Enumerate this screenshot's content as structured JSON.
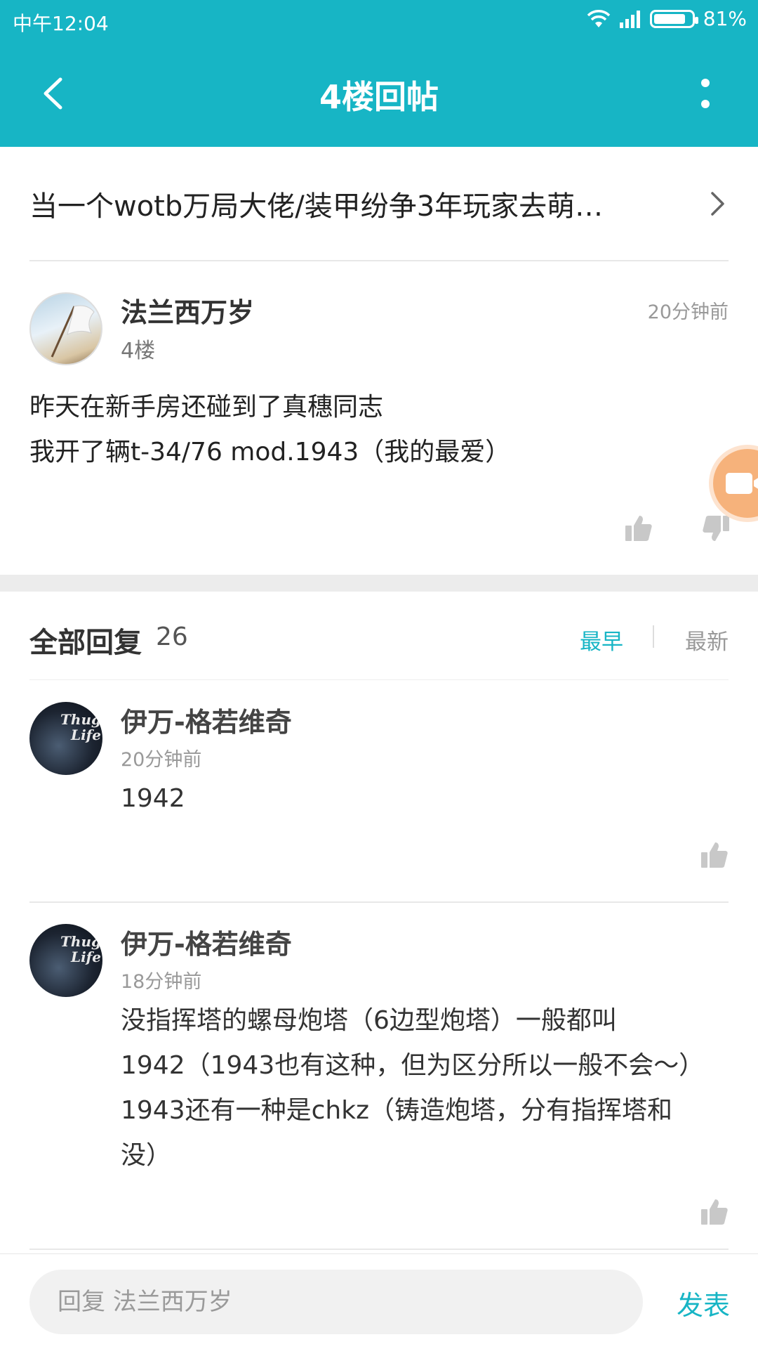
{
  "status_bar": {
    "time": "中午12:04",
    "battery": "81%",
    "icons": [
      "wifi-icon",
      "signal-icon",
      "battery-icon"
    ]
  },
  "header": {
    "title": "4楼回帖",
    "back_icon": "chevron-left-icon",
    "more_icon": "more-vertical-icon"
  },
  "thread": {
    "title": "当一个wotb万局大佬/装甲纷争3年玩家去萌…"
  },
  "post": {
    "author": "法兰西万岁",
    "floor": "4楼",
    "time": "20分钟前",
    "lines": [
      "昨天在新手房还碰到了真穗同志",
      "我开了辆t-34/76 mod.1943（我的最爱）"
    ]
  },
  "replies": {
    "label": "全部回复",
    "count": "26",
    "sort_earliest": "最早",
    "sort_newest": "最新",
    "active_sort": "最早",
    "items": [
      {
        "author": "伊万-格若维奇",
        "time": "20分钟前",
        "lines": [
          "1942"
        ],
        "avatar_text": [
          "Thug",
          "Life"
        ]
      },
      {
        "author": "伊万-格若维奇",
        "time": "18分钟前",
        "lines": [
          "没指挥塔的螺母炮塔（6边型炮塔）一般都叫",
          "1942（1943也有这种，但为区分所以一般不会～）",
          "1943还有一种是chkz（铸造炮塔，分有指挥塔和",
          "没）"
        ],
        "avatar_text": [
          "Thug",
          "Life"
        ]
      }
    ]
  },
  "reply_bar": {
    "placeholder": "回复 法兰西万岁",
    "send_label": "发表"
  },
  "colors": {
    "accent": "#17b5c5",
    "fab": "#f6b27b"
  }
}
